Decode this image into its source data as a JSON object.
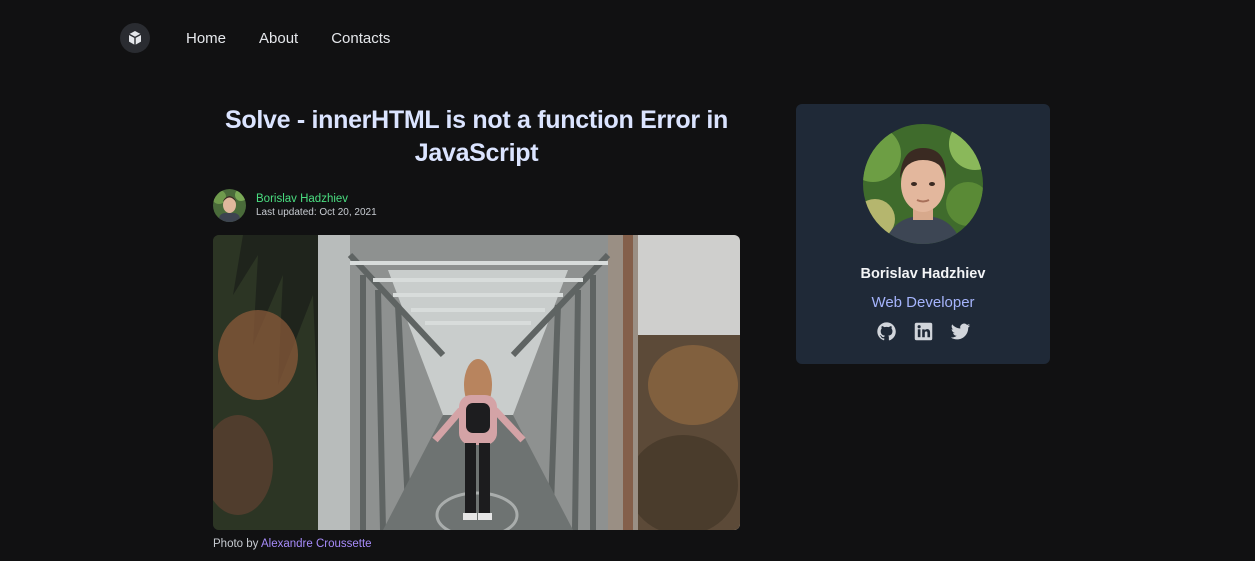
{
  "nav": {
    "logo_icon": "cube-icon",
    "links": [
      "Home",
      "About",
      "Contacts"
    ]
  },
  "article": {
    "title": "Solve - innerHTML is not a function Error in JavaScript",
    "author": "Borislav Hadzhiev",
    "updated": "Last updated: Oct 20, 2021",
    "caption_prefix": "Photo by",
    "photographer": "Alexandre Croussette"
  },
  "profile": {
    "name": "Borislav Hadzhiev",
    "role": "Web Developer",
    "socials": [
      "github-icon",
      "linkedin-icon",
      "twitter-icon"
    ]
  },
  "colors": {
    "background": "#111112",
    "card": "#1f2937",
    "author_green": "#4ade80",
    "role_indigo": "#a5b4fc",
    "link_purple": "#a78bfa"
  }
}
